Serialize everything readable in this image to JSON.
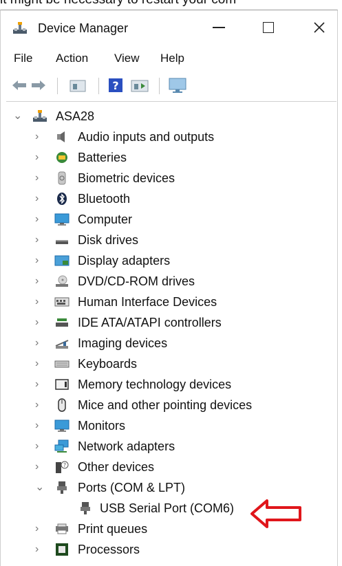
{
  "top_text": "it might be necessary to restart your com",
  "window": {
    "title": "Device Manager"
  },
  "menu": {
    "file": "File",
    "action": "Action",
    "view": "View",
    "help": "Help"
  },
  "toolbar": {
    "buttons": [
      "back-icon",
      "forward-icon",
      "properties-icon",
      "help-icon",
      "run-icon",
      "monitor-icon"
    ]
  },
  "tree": {
    "root": "ASA28",
    "categories": [
      "Audio inputs and outputs",
      "Batteries",
      "Biometric devices",
      "Bluetooth",
      "Computer",
      "Disk drives",
      "Display adapters",
      "DVD/CD-ROM drives",
      "Human Interface Devices",
      "IDE ATA/ATAPI controllers",
      "Imaging devices",
      "Keyboards",
      "Memory technology devices",
      "Mice and other pointing devices",
      "Monitors",
      "Network adapters",
      "Other devices",
      "Ports (COM & LPT)",
      "USB Serial Port (COM6)",
      "Print queues",
      "Processors"
    ]
  },
  "colors": {
    "annotation_arrow": "#e0161b"
  }
}
